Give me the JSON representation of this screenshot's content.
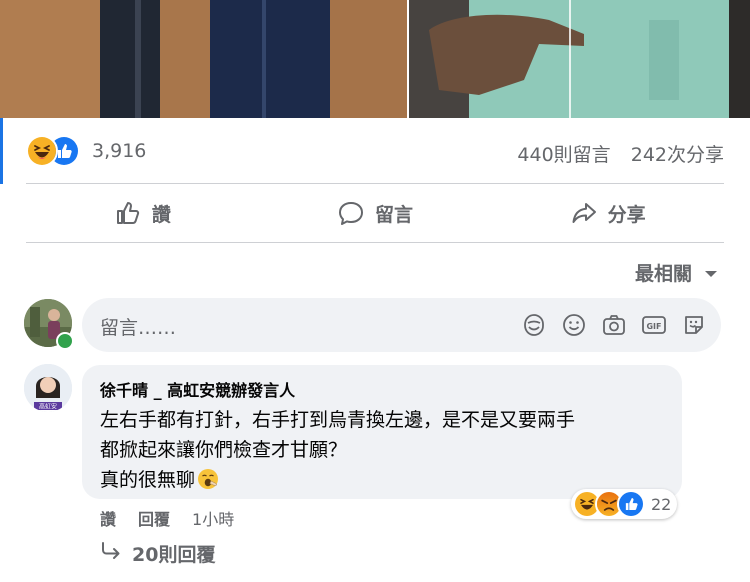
{
  "post": {
    "reactions": {
      "icons": [
        "haha-reaction-icon",
        "like-reaction-icon"
      ],
      "count": "3,916"
    },
    "comment_count": "440則留言",
    "share_count": "242次分享",
    "actions": {
      "like": "讚",
      "comment": "留言",
      "share": "分享"
    }
  },
  "sort": {
    "label": "最相關"
  },
  "composer": {
    "placeholder": "留言……",
    "icons": [
      "sticker-icon",
      "emoji-icon",
      "camera-icon",
      "gif-icon",
      "avatar-sticker-icon"
    ]
  },
  "comments": [
    {
      "author": "徐千晴 _ 高虹安競辦發言人",
      "avatar_tag": "高虹安",
      "lines": [
        "左右手都有打針，右手打到烏青換左邊，是不是又要兩手",
        "都掀起來讓你們檢查才甘願？",
        "真的很無聊"
      ],
      "reactions": {
        "icons": [
          "haha-reaction-icon",
          "angry-reaction-icon",
          "like-reaction-icon"
        ],
        "count": "22"
      },
      "actions": {
        "like": "讚",
        "reply": "回覆",
        "time": "1小時"
      },
      "replies_link": "20則回覆"
    }
  ],
  "colors": {
    "accent": "#1b74e4",
    "secondary_text": "#65676b",
    "bubble": "#f0f2f5",
    "divider": "#ced0d4"
  }
}
